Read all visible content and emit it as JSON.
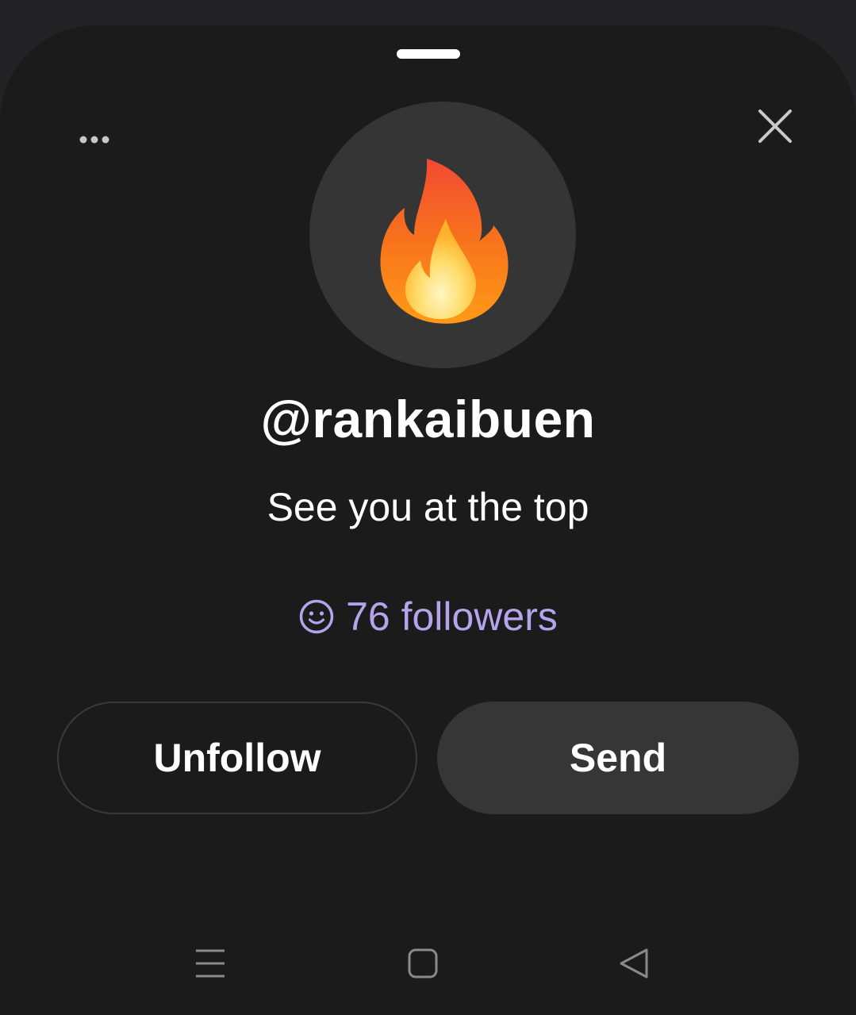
{
  "profile": {
    "username": "@rankaibuen",
    "bio": "See you at the top",
    "followers_label": "76 followers",
    "avatar_icon": "fire-emoji"
  },
  "actions": {
    "unfollow_label": "Unfollow",
    "send_label": "Send"
  },
  "header": {
    "more_icon": "more-horizontal-icon",
    "close_icon": "close-icon"
  },
  "navbar": {
    "items": [
      "menu-icon",
      "home-icon",
      "back-icon"
    ]
  },
  "colors": {
    "background": "#1b1b1c",
    "accent": "#b3a5ec",
    "button_fill": "#363637"
  }
}
